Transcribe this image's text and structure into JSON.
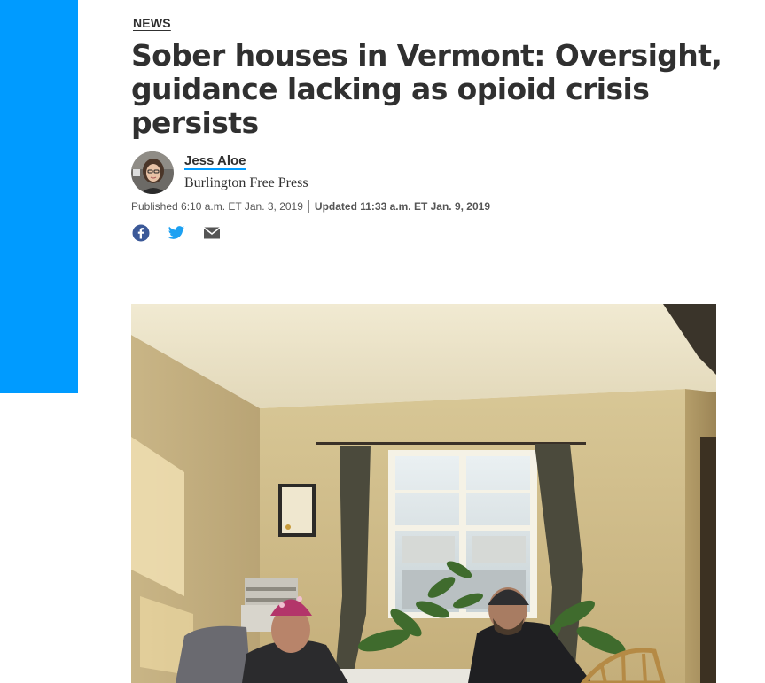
{
  "colors": {
    "accent": "#009bff",
    "headline": "#303030",
    "facebook": "#3b5998",
    "twitter": "#1da1f2",
    "email": "#555555"
  },
  "article": {
    "section": "NEWS",
    "headline": "Sober houses in Vermont: Oversight, guidance lacking as opioid crisis persists",
    "author": {
      "name": "Jess Aloe",
      "publication": "Burlington Free Press"
    },
    "published": "Published 6:10 a.m. ET Jan. 3, 2019",
    "updated": "Updated 11:33 a.m. ET Jan. 9, 2019"
  },
  "share": {
    "icons": [
      "facebook-icon",
      "twitter-icon",
      "email-icon"
    ]
  },
  "hero_image": {
    "description_icon": "photo"
  }
}
